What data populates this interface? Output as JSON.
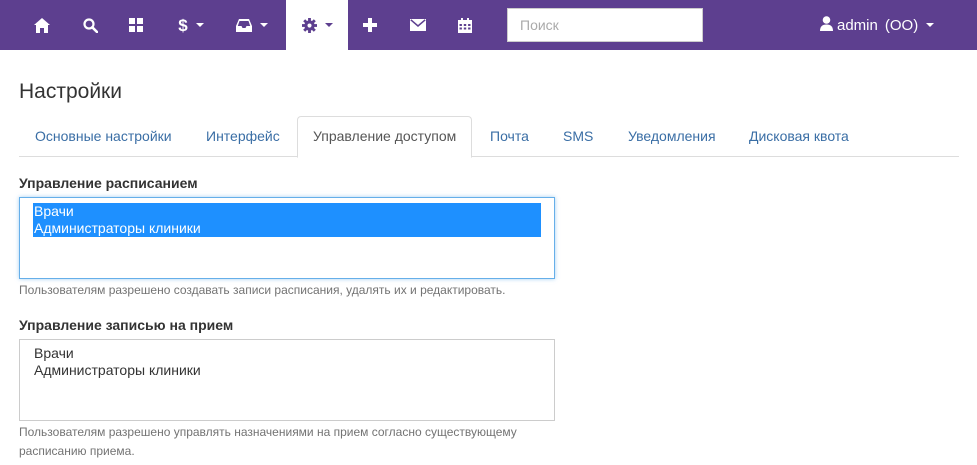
{
  "navbar": {
    "bg_color": "#5d3f8f",
    "icons": [
      "home-icon",
      "search-icon",
      "dashboard-grid-icon",
      "dollar-icon",
      "inbox-icon",
      "gear-icon",
      "plus-icon",
      "envelope-icon",
      "calendar-icon"
    ],
    "dollar_symbol": "$",
    "search_placeholder": "Поиск",
    "user_name": "admin",
    "user_org": "(ОО)"
  },
  "page": {
    "title": "Настройки"
  },
  "tabs": [
    {
      "label": "Основные настройки",
      "active": false
    },
    {
      "label": "Интерфейс",
      "active": false
    },
    {
      "label": "Управление доступом",
      "active": true
    },
    {
      "label": "Почта",
      "active": false
    },
    {
      "label": "SMS",
      "active": false
    },
    {
      "label": "Уведомления",
      "active": false
    },
    {
      "label": "Дисковая квота",
      "active": false
    }
  ],
  "fields": [
    {
      "label": "Управление расписанием",
      "options": [
        {
          "label": "Врачи",
          "selected": true
        },
        {
          "label": "Администраторы клиники",
          "selected": true
        }
      ],
      "help": "Пользователям разрешено создавать записи расписания, удалять их и редактировать."
    },
    {
      "label": "Управление записью на прием",
      "options": [
        {
          "label": "Врачи",
          "selected": false
        },
        {
          "label": "Администраторы клиники",
          "selected": false
        }
      ],
      "help": "Пользователям разрешено управлять назначениями на прием согласно существующему расписанию приема."
    }
  ],
  "colors": {
    "accent": "#5d3f8f",
    "link": "#3a6ea5",
    "selection": "#1e90ff"
  }
}
